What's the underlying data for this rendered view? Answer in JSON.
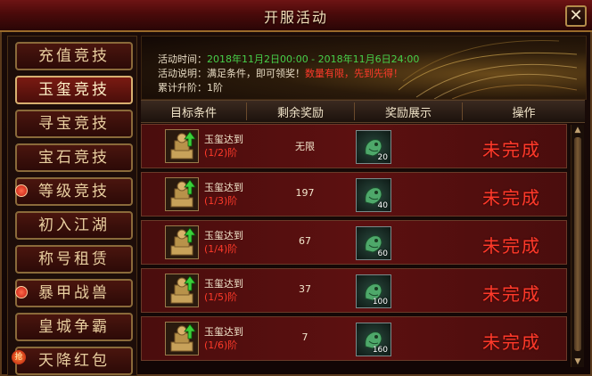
{
  "window": {
    "title": "开服活动",
    "close_label": "✕"
  },
  "sidebar": {
    "items": [
      {
        "label": "充值竞技",
        "active": false,
        "badge": ""
      },
      {
        "label": "玉玺竞技",
        "active": true,
        "badge": ""
      },
      {
        "label": "寻宝竞技",
        "active": false,
        "badge": ""
      },
      {
        "label": "宝石竞技",
        "active": false,
        "badge": ""
      },
      {
        "label": "等级竞技",
        "active": false,
        "badge": "dot"
      },
      {
        "label": "初入江湖",
        "active": false,
        "badge": ""
      },
      {
        "label": "称号租赁",
        "active": false,
        "badge": ""
      },
      {
        "label": "暴甲战兽",
        "active": false,
        "badge": "dot"
      },
      {
        "label": "皇城争霸",
        "active": false,
        "badge": ""
      },
      {
        "label": "天降红包",
        "active": false,
        "badge": "抢"
      }
    ]
  },
  "info": {
    "time_label": "活动时间：",
    "time_value": "2018年11月2日00:00 - 2018年11月6日24:00",
    "desc_label": "活动说明：满足条件，即可领奖！",
    "desc_highlight": "数量有限，先到先得！",
    "progress": "累计升阶：1阶"
  },
  "table": {
    "headers": [
      "目标条件",
      "剩余奖励",
      "奖励展示",
      "操作"
    ],
    "rows": [
      {
        "name": "玉玺达到",
        "tier": "(1/2)阶",
        "remaining": "无限",
        "reward_count": "20",
        "status": "未完成"
      },
      {
        "name": "玉玺达到",
        "tier": "(1/3)阶",
        "remaining": "197",
        "reward_count": "40",
        "status": "未完成"
      },
      {
        "name": "玉玺达到",
        "tier": "(1/4)阶",
        "remaining": "67",
        "reward_count": "60",
        "status": "未完成"
      },
      {
        "name": "玉玺达到",
        "tier": "(1/5)阶",
        "remaining": "37",
        "reward_count": "100",
        "status": "未完成"
      },
      {
        "name": "玉玺达到",
        "tier": "(1/6)阶",
        "remaining": "7",
        "reward_count": "160",
        "status": "未完成"
      }
    ]
  },
  "icons": {
    "seal": "jade-seal-icon",
    "reward": "jade-dragon-icon",
    "upgrade": "green-arrow-up-icon"
  },
  "colors": {
    "accent_red": "#ff3a2a",
    "accent_green": "#47d04a",
    "gold_text": "#e9cfa0"
  }
}
